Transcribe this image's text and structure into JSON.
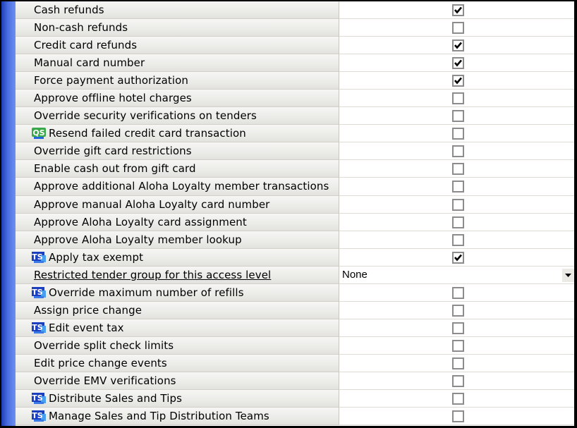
{
  "rows": [
    {
      "label": "Cash refunds",
      "checked": true
    },
    {
      "label": "Non-cash refunds",
      "checked": false
    },
    {
      "label": "Credit card refunds",
      "checked": true
    },
    {
      "label": "Manual card number",
      "checked": true
    },
    {
      "label": "Force payment authorization",
      "checked": true
    },
    {
      "label": "Approve offline hotel charges",
      "checked": false
    },
    {
      "label": "Override security verifications on tenders",
      "checked": false
    },
    {
      "label": "Resend failed credit card transaction",
      "checked": false,
      "badge": "QS"
    },
    {
      "label": "Override gift card restrictions",
      "checked": false
    },
    {
      "label": "Enable cash out from gift card",
      "checked": false
    },
    {
      "label": "Approve additional Aloha Loyalty member transactions",
      "checked": false
    },
    {
      "label": "Approve manual Aloha Loyalty card number",
      "checked": false
    },
    {
      "label": "Approve Aloha Loyalty card assignment",
      "checked": false
    },
    {
      "label": "Approve Aloha Loyalty member lookup",
      "checked": false
    },
    {
      "label": "Apply tax exempt",
      "checked": true,
      "badge": "TS"
    },
    {
      "label": "Restricted tender group for this access level",
      "type": "dropdown",
      "value": "None"
    },
    {
      "label": "Override maximum number of refills",
      "checked": false,
      "badge": "TS"
    },
    {
      "label": "Assign price change",
      "checked": false
    },
    {
      "label": "Edit event tax",
      "checked": false,
      "badge": "TS"
    },
    {
      "label": "Override split check limits",
      "checked": false
    },
    {
      "label": "Edit price change events",
      "checked": false
    },
    {
      "label": "Override EMV verifications",
      "checked": false
    },
    {
      "label": "Distribute Sales and Tips",
      "checked": false,
      "badge": "TS"
    },
    {
      "label": "Manage Sales and Tip Distribution Teams",
      "checked": false,
      "badge": "TS"
    }
  ],
  "colors": {
    "accent_bar": "#2f54cc",
    "qs_badge": "#2e9e3a",
    "ts_badge": "#1a3fbf"
  }
}
